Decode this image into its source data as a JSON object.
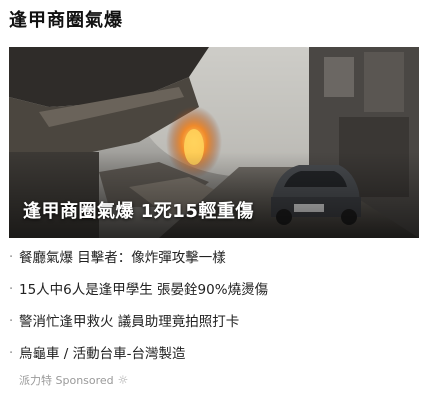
{
  "section": {
    "title": "逢甲商圈氣爆"
  },
  "hero": {
    "caption": "逢甲商圈氣爆 1死15輕重傷",
    "image_label": "burned car and damaged storefronts after gas explosion"
  },
  "headlines": [
    {
      "text": "餐廳氣爆 目擊者：像炸彈攻擊一樣"
    },
    {
      "text": "15人中6人是逢甲學生 張晏銓90%燒燙傷"
    },
    {
      "text": "警消忙逢甲救火 議員助理竟拍照打卡"
    },
    {
      "text": "烏龜車 / 活動台車-台灣製造"
    }
  ],
  "sponsored": {
    "label": "派力特 Sponsored",
    "icon": "sun-icon"
  }
}
